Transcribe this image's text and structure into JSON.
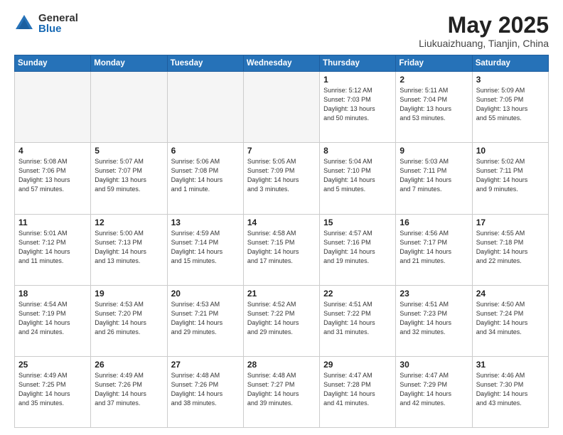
{
  "header": {
    "logo_general": "General",
    "logo_blue": "Blue",
    "month_year": "May 2025",
    "location": "Liukuaizhuang, Tianjin, China"
  },
  "weekdays": [
    "Sunday",
    "Monday",
    "Tuesday",
    "Wednesday",
    "Thursday",
    "Friday",
    "Saturday"
  ],
  "weeks": [
    [
      {
        "day": "",
        "info": ""
      },
      {
        "day": "",
        "info": ""
      },
      {
        "day": "",
        "info": ""
      },
      {
        "day": "",
        "info": ""
      },
      {
        "day": "1",
        "info": "Sunrise: 5:12 AM\nSunset: 7:03 PM\nDaylight: 13 hours\nand 50 minutes."
      },
      {
        "day": "2",
        "info": "Sunrise: 5:11 AM\nSunset: 7:04 PM\nDaylight: 13 hours\nand 53 minutes."
      },
      {
        "day": "3",
        "info": "Sunrise: 5:09 AM\nSunset: 7:05 PM\nDaylight: 13 hours\nand 55 minutes."
      }
    ],
    [
      {
        "day": "4",
        "info": "Sunrise: 5:08 AM\nSunset: 7:06 PM\nDaylight: 13 hours\nand 57 minutes."
      },
      {
        "day": "5",
        "info": "Sunrise: 5:07 AM\nSunset: 7:07 PM\nDaylight: 13 hours\nand 59 minutes."
      },
      {
        "day": "6",
        "info": "Sunrise: 5:06 AM\nSunset: 7:08 PM\nDaylight: 14 hours\nand 1 minute."
      },
      {
        "day": "7",
        "info": "Sunrise: 5:05 AM\nSunset: 7:09 PM\nDaylight: 14 hours\nand 3 minutes."
      },
      {
        "day": "8",
        "info": "Sunrise: 5:04 AM\nSunset: 7:10 PM\nDaylight: 14 hours\nand 5 minutes."
      },
      {
        "day": "9",
        "info": "Sunrise: 5:03 AM\nSunset: 7:11 PM\nDaylight: 14 hours\nand 7 minutes."
      },
      {
        "day": "10",
        "info": "Sunrise: 5:02 AM\nSunset: 7:11 PM\nDaylight: 14 hours\nand 9 minutes."
      }
    ],
    [
      {
        "day": "11",
        "info": "Sunrise: 5:01 AM\nSunset: 7:12 PM\nDaylight: 14 hours\nand 11 minutes."
      },
      {
        "day": "12",
        "info": "Sunrise: 5:00 AM\nSunset: 7:13 PM\nDaylight: 14 hours\nand 13 minutes."
      },
      {
        "day": "13",
        "info": "Sunrise: 4:59 AM\nSunset: 7:14 PM\nDaylight: 14 hours\nand 15 minutes."
      },
      {
        "day": "14",
        "info": "Sunrise: 4:58 AM\nSunset: 7:15 PM\nDaylight: 14 hours\nand 17 minutes."
      },
      {
        "day": "15",
        "info": "Sunrise: 4:57 AM\nSunset: 7:16 PM\nDaylight: 14 hours\nand 19 minutes."
      },
      {
        "day": "16",
        "info": "Sunrise: 4:56 AM\nSunset: 7:17 PM\nDaylight: 14 hours\nand 21 minutes."
      },
      {
        "day": "17",
        "info": "Sunrise: 4:55 AM\nSunset: 7:18 PM\nDaylight: 14 hours\nand 22 minutes."
      }
    ],
    [
      {
        "day": "18",
        "info": "Sunrise: 4:54 AM\nSunset: 7:19 PM\nDaylight: 14 hours\nand 24 minutes."
      },
      {
        "day": "19",
        "info": "Sunrise: 4:53 AM\nSunset: 7:20 PM\nDaylight: 14 hours\nand 26 minutes."
      },
      {
        "day": "20",
        "info": "Sunrise: 4:53 AM\nSunset: 7:21 PM\nDaylight: 14 hours\nand 29 minutes."
      },
      {
        "day": "21",
        "info": "Sunrise: 4:52 AM\nSunset: 7:22 PM\nDaylight: 14 hours\nand 29 minutes."
      },
      {
        "day": "22",
        "info": "Sunrise: 4:51 AM\nSunset: 7:22 PM\nDaylight: 14 hours\nand 31 minutes."
      },
      {
        "day": "23",
        "info": "Sunrise: 4:51 AM\nSunset: 7:23 PM\nDaylight: 14 hours\nand 32 minutes."
      },
      {
        "day": "24",
        "info": "Sunrise: 4:50 AM\nSunset: 7:24 PM\nDaylight: 14 hours\nand 34 minutes."
      }
    ],
    [
      {
        "day": "25",
        "info": "Sunrise: 4:49 AM\nSunset: 7:25 PM\nDaylight: 14 hours\nand 35 minutes."
      },
      {
        "day": "26",
        "info": "Sunrise: 4:49 AM\nSunset: 7:26 PM\nDaylight: 14 hours\nand 37 minutes."
      },
      {
        "day": "27",
        "info": "Sunrise: 4:48 AM\nSunset: 7:26 PM\nDaylight: 14 hours\nand 38 minutes."
      },
      {
        "day": "28",
        "info": "Sunrise: 4:48 AM\nSunset: 7:27 PM\nDaylight: 14 hours\nand 39 minutes."
      },
      {
        "day": "29",
        "info": "Sunrise: 4:47 AM\nSunset: 7:28 PM\nDaylight: 14 hours\nand 41 minutes."
      },
      {
        "day": "30",
        "info": "Sunrise: 4:47 AM\nSunset: 7:29 PM\nDaylight: 14 hours\nand 42 minutes."
      },
      {
        "day": "31",
        "info": "Sunrise: 4:46 AM\nSunset: 7:30 PM\nDaylight: 14 hours\nand 43 minutes."
      }
    ]
  ]
}
